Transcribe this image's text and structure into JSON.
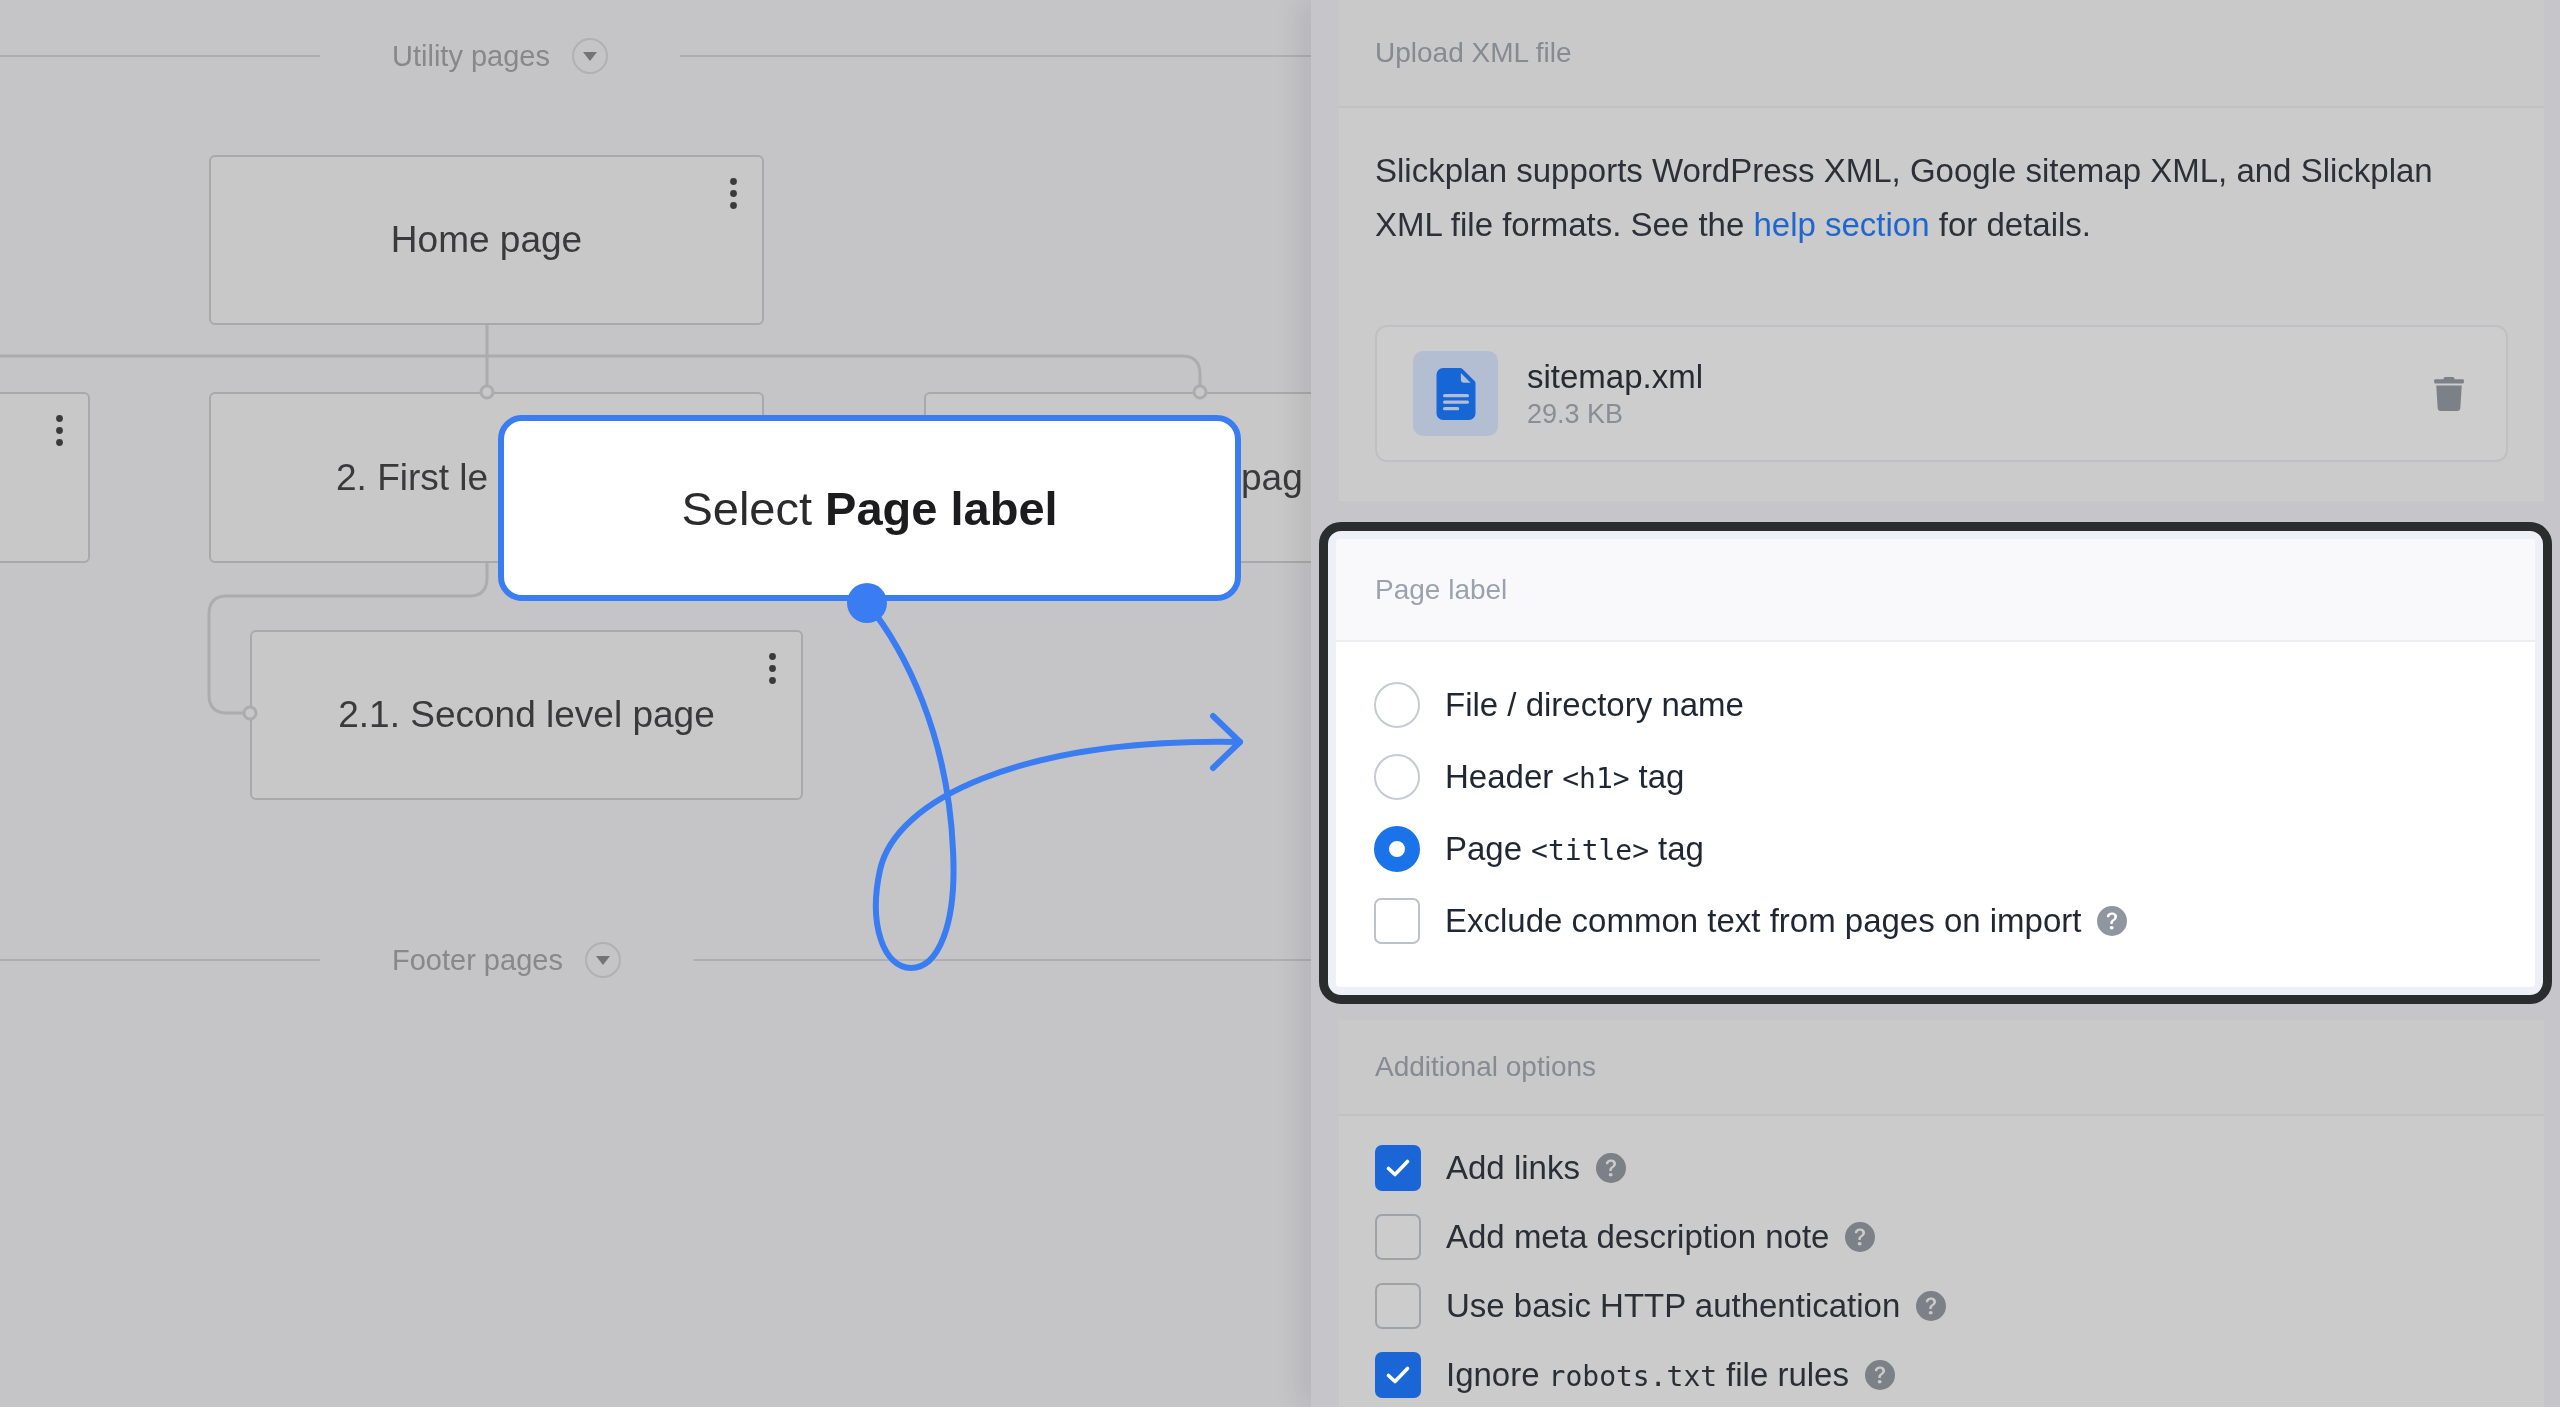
{
  "sitemap": {
    "sections": [
      {
        "label": "Utility pages"
      },
      {
        "label": "Footer pages"
      }
    ],
    "pages": [
      {
        "label": "Home page",
        "menu_icon": true,
        "children": [
          {
            "menu_icon": true
          },
          {
            "label": "2. First le",
            "menu_icon": false,
            "children": [
              {
                "label": "2.1. Second level page",
                "menu_icon": true
              }
            ]
          },
          {
            "label": "pag",
            "menu_icon": false
          }
        ]
      }
    ]
  },
  "callout": {
    "text": "Select **Page label**"
  },
  "upload": {
    "title": "Upload XML file",
    "description": "Slickplan supports WordPress XML, Google sitemap XML, and Slickplan XML file formats. See the",
    "link": "help section",
    "description_end": "for details.",
    "file": {
      "name": "sitemap.xml",
      "size": "29.3 KB"
    }
  },
  "page_label": {
    "title": "Page label",
    "options": [
      {
        "parts": [
          {
            "kind": "text",
            "text": "File / directory name"
          }
        ],
        "selected": false
      },
      {
        "parts": [
          {
            "kind": "text",
            "text": "Header"
          },
          {
            "kind": "code",
            "text": "<h1>"
          },
          {
            "kind": "text",
            "text": "tag"
          }
        ],
        "selected": false
      },
      {
        "parts": [
          {
            "kind": "text",
            "text": "Page"
          },
          {
            "kind": "code",
            "text": "<title>"
          },
          {
            "kind": "text",
            "text": "tag"
          }
        ],
        "selected": true
      }
    ],
    "checkboxes": [
      {
        "parts": [
          {
            "kind": "text",
            "text": "Exclude common text from pages on import"
          }
        ],
        "checked": false
      }
    ]
  },
  "additional_options": {
    "title": "Additional options",
    "checkboxes": [
      {
        "parts": [
          {
            "kind": "text",
            "text": "Add links"
          }
        ],
        "checked": true
      },
      {
        "parts": [
          {
            "kind": "text",
            "text": "Add meta description note"
          }
        ],
        "checked": false
      },
      {
        "parts": [
          {
            "kind": "text",
            "text": "Use basic HTTP authentication"
          }
        ],
        "checked": false
      },
      {
        "parts": [
          {
            "kind": "text",
            "text": "Ignore"
          },
          {
            "kind": "code",
            "text": "robots.txt"
          },
          {
            "kind": "text",
            "text": "file rules"
          }
        ],
        "checked": true
      }
    ]
  }
}
